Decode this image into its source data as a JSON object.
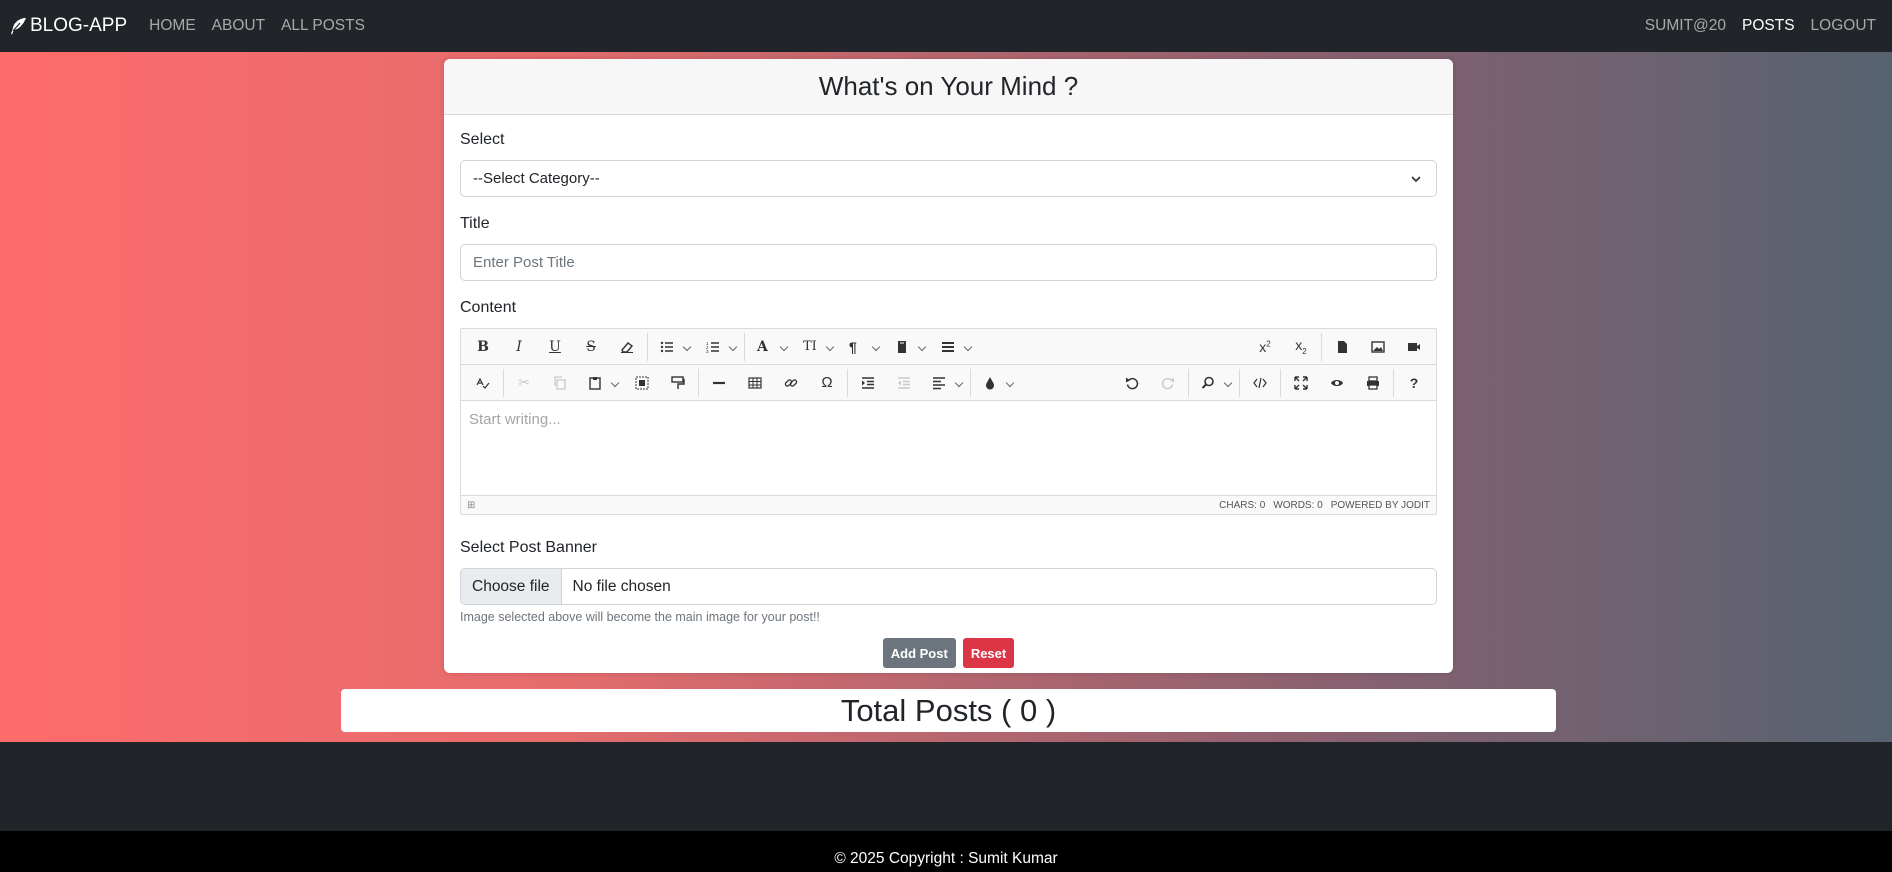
{
  "navbar": {
    "brand": "BLOG-APP",
    "links": [
      "HOME",
      "ABOUT",
      "ALL POSTS"
    ],
    "right_links": [
      "SUMIT@20",
      "POSTS",
      "LOGOUT"
    ]
  },
  "form": {
    "heading": "What's on Your Mind ?",
    "select_label": "Select",
    "select_value": "--Select Category--",
    "title_label": "Title",
    "title_placeholder": "Enter Post Title",
    "content_label": "Content",
    "editor_placeholder": "Start writing...",
    "editor_status": {
      "chars": "CHARS: 0",
      "words": "WORDS: 0",
      "powered": "POWERED BY JODIT"
    },
    "banner_label": "Select Post Banner",
    "file_button": "Choose file",
    "file_status": "No file chosen",
    "help_text": "Image selected above will become the main image for your post!!",
    "add_button": "Add Post",
    "reset_button": "Reset"
  },
  "total_posts": "Total Posts ( 0 )",
  "footer": "© 2025 Copyright : Sumit Kumar",
  "colors": {
    "navbar": "#212529",
    "gradient_start": "#ff6b6b",
    "gradient_end": "#566270",
    "add_button": "#6c757d",
    "reset_button": "#dc3545"
  }
}
